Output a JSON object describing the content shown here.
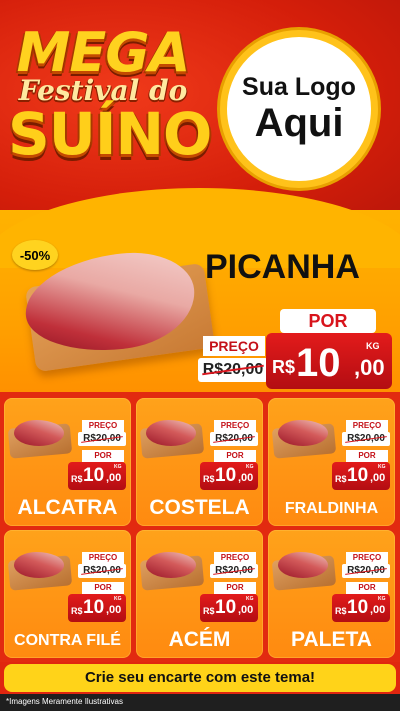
{
  "header": {
    "title_line1": "MEGA",
    "title_line2": "Festival do",
    "title_line3": "SUÍNO",
    "logo_line1": "Sua Logo",
    "logo_line2": "Aqui"
  },
  "featured": {
    "discount": "-50%",
    "name": "PICANHA",
    "preco_label": "PREÇO",
    "old_price": "R$20,00",
    "por_label": "POR",
    "currency": "R$",
    "price_int": "10",
    "price_dec": ",00",
    "unit": "KG"
  },
  "products": [
    {
      "name": "ALCATRA",
      "preco_label": "PREÇO",
      "old_price": "R$20,00",
      "por_label": "POR",
      "currency": "R$",
      "price_int": "10",
      "price_dec": ",00",
      "unit": "KG"
    },
    {
      "name": "COSTELA",
      "preco_label": "PREÇO",
      "old_price": "R$20,00",
      "por_label": "POR",
      "currency": "R$",
      "price_int": "10",
      "price_dec": ",00",
      "unit": "KG"
    },
    {
      "name": "FRALDINHA",
      "preco_label": "PREÇO",
      "old_price": "R$20,00",
      "por_label": "POR",
      "currency": "R$",
      "price_int": "10",
      "price_dec": ",00",
      "unit": "KG"
    },
    {
      "name": "CONTRA FILÉ",
      "preco_label": "PREÇO",
      "old_price": "R$20,00",
      "por_label": "POR",
      "currency": "R$",
      "price_int": "10",
      "price_dec": ",00",
      "unit": "KG"
    },
    {
      "name": "ACÉM",
      "preco_label": "PREÇO",
      "old_price": "R$20,00",
      "por_label": "POR",
      "currency": "R$",
      "price_int": "10",
      "price_dec": ",00",
      "unit": "KG"
    },
    {
      "name": "PALETA",
      "preco_label": "PREÇO",
      "old_price": "R$20,00",
      "por_label": "POR",
      "currency": "R$",
      "price_int": "10",
      "price_dec": ",00",
      "unit": "KG"
    }
  ],
  "footer": {
    "cta": "Crie seu encarte com este tema!",
    "disclaimer": "*Imagens Meramente Ilustrativas"
  },
  "colors": {
    "brand_red": "#e0260f",
    "brand_yellow": "#ffd319",
    "price_red": "#d8141c",
    "card_orange": "#ff8a10"
  }
}
